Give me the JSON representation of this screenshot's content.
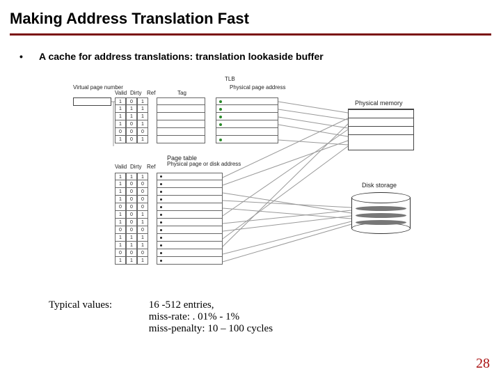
{
  "title": "Making Address Translation Fast",
  "bullet": "A cache for address translations:  translation lookaside buffer",
  "diagram": {
    "tlb_title": "TLB",
    "headers": {
      "vpn": "Virtual page\nnumber",
      "valid": "Valid",
      "dirty": "Dirty",
      "ref": "Ref",
      "tag": "Tag",
      "ppa": "Physical page\naddress"
    },
    "tlb_rows": [
      {
        "v": "1",
        "d": "0",
        "r": "1"
      },
      {
        "v": "1",
        "d": "1",
        "r": "1"
      },
      {
        "v": "1",
        "d": "1",
        "r": "1"
      },
      {
        "v": "1",
        "d": "0",
        "r": "1"
      },
      {
        "v": "0",
        "d": "0",
        "r": "0"
      },
      {
        "v": "1",
        "d": "0",
        "r": "1"
      }
    ],
    "pt_title": "Page table",
    "pt_headers": {
      "valid": "Valid",
      "dirty": "Dirty",
      "ref": "Ref",
      "ppd": "Physical page\nor disk address"
    },
    "pt_rows": [
      {
        "v": "1",
        "d": "1",
        "r": "1"
      },
      {
        "v": "1",
        "d": "0",
        "r": "0"
      },
      {
        "v": "1",
        "d": "0",
        "r": "0"
      },
      {
        "v": "1",
        "d": "0",
        "r": "0"
      },
      {
        "v": "0",
        "d": "0",
        "r": "0"
      },
      {
        "v": "1",
        "d": "0",
        "r": "1"
      },
      {
        "v": "1",
        "d": "0",
        "r": "1"
      },
      {
        "v": "0",
        "d": "0",
        "r": "0"
      },
      {
        "v": "1",
        "d": "1",
        "r": "1"
      },
      {
        "v": "1",
        "d": "1",
        "r": "1"
      },
      {
        "v": "0",
        "d": "0",
        "r": "0"
      },
      {
        "v": "1",
        "d": "1",
        "r": "1"
      }
    ],
    "phys_mem": "Physical memory",
    "disk": "Disk storage"
  },
  "typical": {
    "label": "Typical values:",
    "l1": "16 -512 entries,",
    "l2": "miss-rate:  . 01% - 1%",
    "l3": "miss-penalty:  10 – 100 cycles"
  },
  "page_number": "28"
}
